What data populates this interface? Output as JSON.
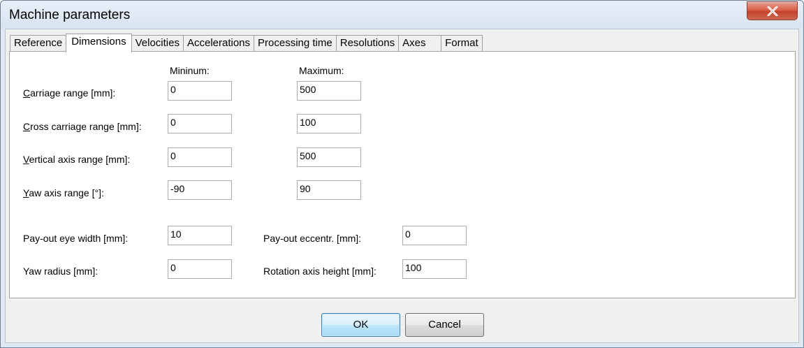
{
  "window": {
    "title": "Machine parameters"
  },
  "tabs": [
    {
      "label": "Reference"
    },
    {
      "label": "Dimensions"
    },
    {
      "label": "Velocities"
    },
    {
      "label": "Accelerations"
    },
    {
      "label": "Processing time"
    },
    {
      "label": "Resolutions"
    },
    {
      "label": "Axes"
    },
    {
      "label": "Format"
    }
  ],
  "active_tab": "Dimensions",
  "headers": {
    "minimum": "Mininum:",
    "maximum": "Maximum:"
  },
  "ranges": [
    {
      "mnemonic": "C",
      "rest": "arriage range [mm]:",
      "min": "0",
      "max": "500"
    },
    {
      "mnemonic": "C",
      "rest": "ross carriage range [mm]:",
      "min": "0",
      "max": "100"
    },
    {
      "mnemonic": "V",
      "rest": "ertical axis range [mm]:",
      "min": "0",
      "max": "500"
    },
    {
      "mnemonic": "Y",
      "rest": "aw axis range [°]:",
      "min": "-90",
      "max": "90"
    }
  ],
  "extras": {
    "payout_eye_width": {
      "label": "Pay-out eye width [mm]:",
      "value": "10"
    },
    "yaw_radius": {
      "label": "Yaw radius [mm]:",
      "value": "0"
    },
    "payout_eccentr": {
      "label": "Pay-out eccentr. [mm]:",
      "value": "0"
    },
    "rotation_axis_height": {
      "label": "Rotation axis height [mm]:",
      "value": "100"
    }
  },
  "buttons": {
    "ok": "OK",
    "cancel": "Cancel"
  },
  "icons": {
    "close": "close-icon"
  }
}
